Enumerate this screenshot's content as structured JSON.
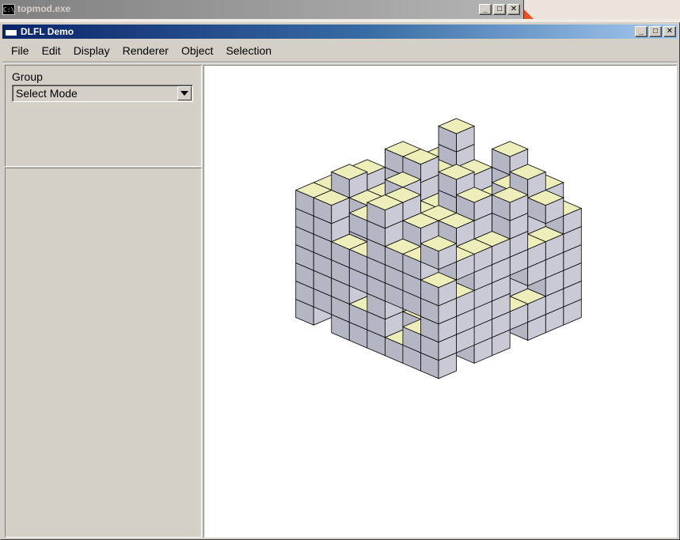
{
  "background_window": {
    "title": "topmod.exe",
    "icon": "console-icon",
    "icon_text": "C:\\",
    "buttons": [
      "minimize-icon",
      "maximize-icon",
      "close-icon"
    ]
  },
  "window": {
    "title": "DLFL Demo",
    "icon": "window-icon",
    "buttons": [
      "minimize-icon",
      "maximize-icon",
      "close-icon"
    ]
  },
  "menu": {
    "items": [
      "File",
      "Edit",
      "Display",
      "Renderer",
      "Object",
      "Selection"
    ]
  },
  "left_panel": {
    "group_label": "Group",
    "mode_select": {
      "selected": "Select Mode"
    }
  },
  "viewport": {
    "content": "3d-model-cube-lattice",
    "colors": {
      "top_face": "#eeeebb",
      "left_face": "#b4b6c4",
      "right_face": "#c9cad6",
      "edge": "#000000",
      "background": "#ffffff"
    }
  }
}
